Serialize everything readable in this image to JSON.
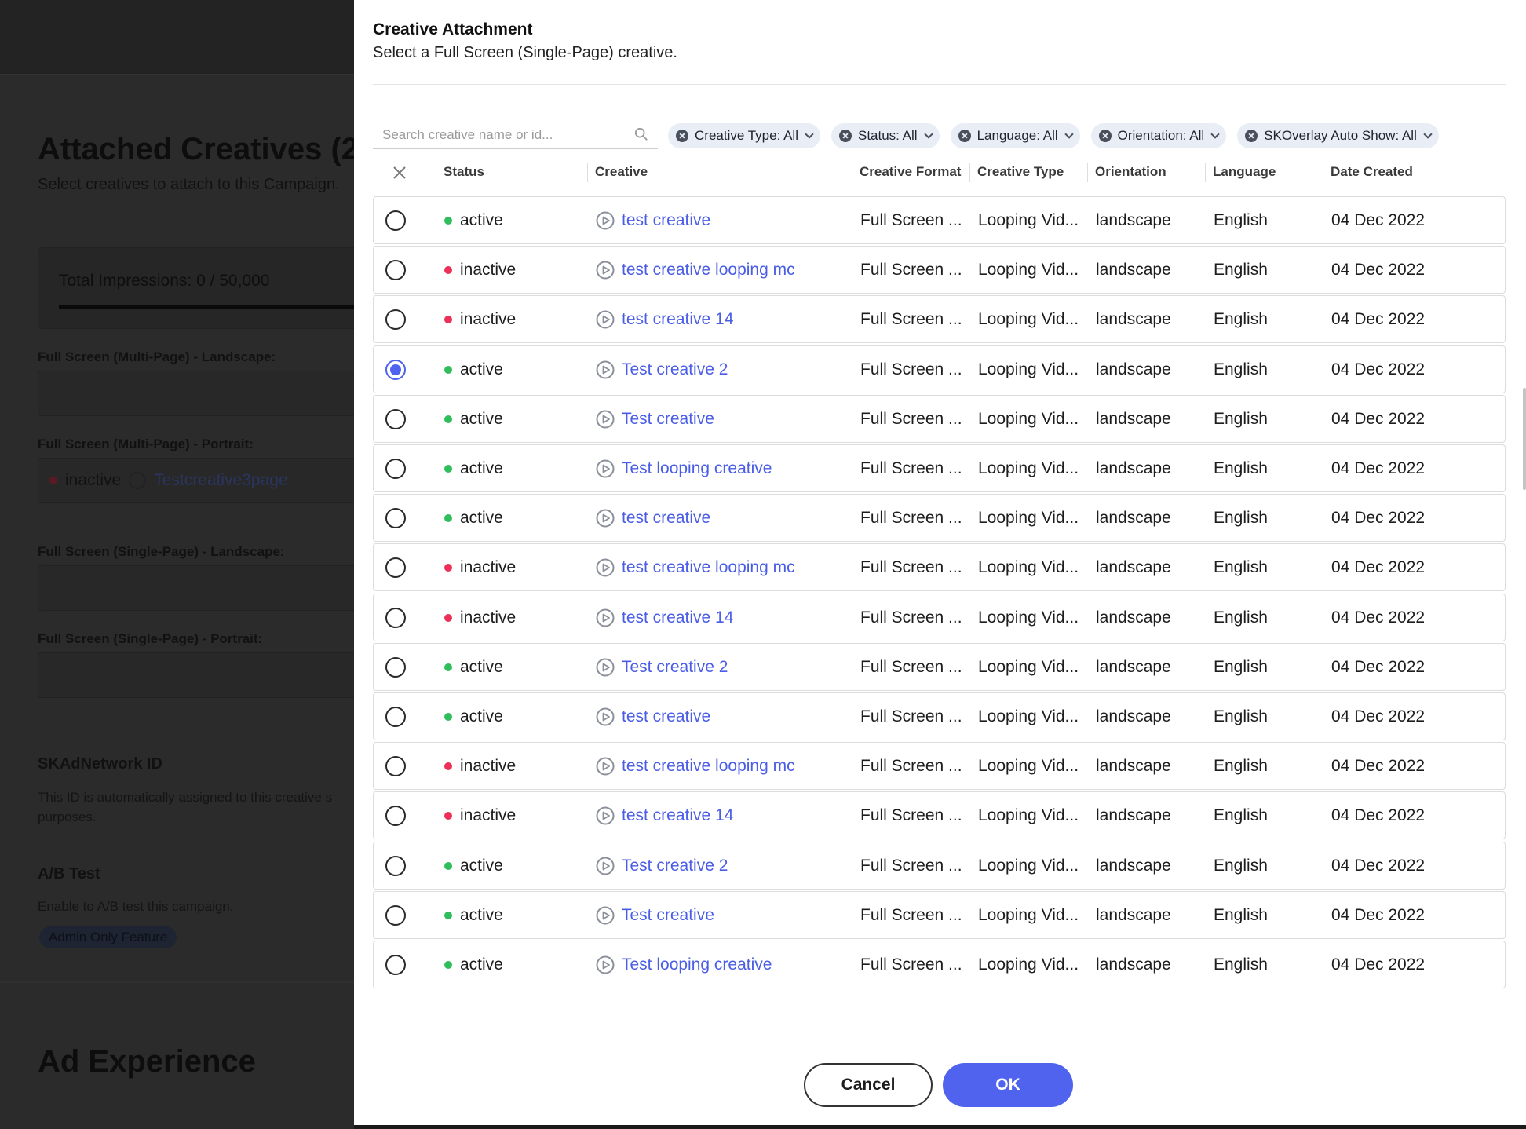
{
  "background": {
    "title": "Attached Creatives (2",
    "subtitle": "Select creatives to attach to this Campaign.",
    "impressions": "Total Impressions: 0 / 50,000",
    "field_multi_landscape": "Full Screen (Multi-Page) - Landscape:",
    "field_multi_portrait": "Full Screen (Multi-Page) - Portrait:",
    "portrait_status": "inactive",
    "portrait_creative": "Testcreative3page",
    "field_single_landscape": "Full Screen (Single-Page) - Landscape:",
    "field_single_portrait": "Full Screen (Single-Page) - Portrait:",
    "skad_title": "SKAdNetwork ID",
    "skad_desc": "This ID is automatically assigned to this creative s",
    "skad_desc2": "purposes.",
    "ab_title": "A/B Test",
    "ab_desc": "Enable to A/B test this campaign.",
    "admin_badge": "Admin Only Feature",
    "ad_experience": "Ad Experience"
  },
  "modal": {
    "title": "Creative Attachment",
    "subtitle": "Select a Full Screen (Single-Page) creative.",
    "search_placeholder": "Search creative name or id...",
    "filters": [
      "Creative Type: All",
      "Status: All",
      "Language: All",
      "Orientation: All",
      "SKOverlay Auto Show: All"
    ],
    "columns": {
      "status": "Status",
      "creative": "Creative",
      "format": "Creative Format",
      "type": "Creative Type",
      "orientation": "Orientation",
      "language": "Language",
      "date": "Date Created"
    },
    "rows": [
      {
        "status": "active",
        "name": "test creative",
        "format": "Full Screen ...",
        "type": "Looping Vid...",
        "orientation": "landscape",
        "language": "English",
        "date": "04 Dec 2022",
        "selected": false
      },
      {
        "status": "inactive",
        "name": "test creative looping mc",
        "format": "Full Screen ...",
        "type": "Looping Vid...",
        "orientation": "landscape",
        "language": "English",
        "date": "04 Dec 2022",
        "selected": false
      },
      {
        "status": "inactive",
        "name": "test creative 14",
        "format": "Full Screen ...",
        "type": "Looping Vid...",
        "orientation": "landscape",
        "language": "English",
        "date": "04 Dec 2022",
        "selected": false
      },
      {
        "status": "active",
        "name": "Test creative 2",
        "format": "Full Screen ...",
        "type": "Looping Vid...",
        "orientation": "landscape",
        "language": "English",
        "date": "04 Dec 2022",
        "selected": true
      },
      {
        "status": "active",
        "name": "Test creative",
        "format": "Full Screen ...",
        "type": "Looping Vid...",
        "orientation": "landscape",
        "language": "English",
        "date": "04 Dec 2022",
        "selected": false
      },
      {
        "status": "active",
        "name": "Test looping creative",
        "format": "Full Screen ...",
        "type": "Looping Vid...",
        "orientation": "landscape",
        "language": "English",
        "date": "04 Dec 2022",
        "selected": false
      },
      {
        "status": "active",
        "name": "test creative",
        "format": "Full Screen ...",
        "type": "Looping Vid...",
        "orientation": "landscape",
        "language": "English",
        "date": "04 Dec 2022",
        "selected": false
      },
      {
        "status": "inactive",
        "name": "test creative looping mc",
        "format": "Full Screen ...",
        "type": "Looping Vid...",
        "orientation": "landscape",
        "language": "English",
        "date": "04 Dec 2022",
        "selected": false
      },
      {
        "status": "inactive",
        "name": "test creative 14",
        "format": "Full Screen ...",
        "type": "Looping Vid...",
        "orientation": "landscape",
        "language": "English",
        "date": "04 Dec 2022",
        "selected": false
      },
      {
        "status": "active",
        "name": "Test creative 2",
        "format": "Full Screen ...",
        "type": "Looping Vid...",
        "orientation": "landscape",
        "language": "English",
        "date": "04 Dec 2022",
        "selected": false
      },
      {
        "status": "active",
        "name": "test creative",
        "format": "Full Screen ...",
        "type": "Looping Vid...",
        "orientation": "landscape",
        "language": "English",
        "date": "04 Dec 2022",
        "selected": false
      },
      {
        "status": "inactive",
        "name": "test creative looping mc",
        "format": "Full Screen ...",
        "type": "Looping Vid...",
        "orientation": "landscape",
        "language": "English",
        "date": "04 Dec 2022",
        "selected": false
      },
      {
        "status": "inactive",
        "name": "test creative 14",
        "format": "Full Screen ...",
        "type": "Looping Vid...",
        "orientation": "landscape",
        "language": "English",
        "date": "04 Dec 2022",
        "selected": false
      },
      {
        "status": "active",
        "name": "Test creative 2",
        "format": "Full Screen ...",
        "type": "Looping Vid...",
        "orientation": "landscape",
        "language": "English",
        "date": "04 Dec 2022",
        "selected": false
      },
      {
        "status": "active",
        "name": "Test creative",
        "format": "Full Screen ...",
        "type": "Looping Vid...",
        "orientation": "landscape",
        "language": "English",
        "date": "04 Dec 2022",
        "selected": false
      },
      {
        "status": "active",
        "name": "Test looping creative",
        "format": "Full Screen ...",
        "type": "Looping Vid...",
        "orientation": "landscape",
        "language": "English",
        "date": "04 Dec 2022",
        "selected": false
      }
    ],
    "cancel_label": "Cancel",
    "ok_label": "OK"
  },
  "colors": {
    "accent": "#4f63ef",
    "active": "#2fbe5b",
    "inactive": "#ec3058",
    "link": "#4a5de6"
  },
  "icons": {
    "search": "search-icon",
    "clear": "close-icon",
    "filter_remove": "close-circle-icon",
    "filter_open": "chevron-down-icon",
    "creative": "play-circle-icon"
  }
}
